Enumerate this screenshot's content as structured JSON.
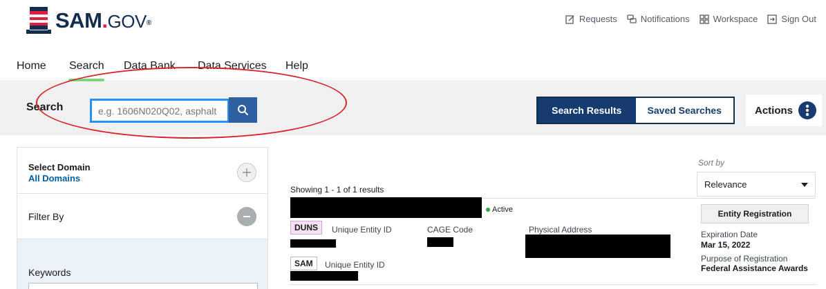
{
  "header": {
    "logo_main": "SAM",
    "logo_dot": ".",
    "logo_gov": "GOV",
    "logo_reg": "®",
    "util": {
      "requests": "Requests",
      "notifications": "Notifications",
      "workspace": "Workspace",
      "sign_out": "Sign Out"
    }
  },
  "nav": {
    "home": "Home",
    "search": "Search",
    "data_bank": "Data Bank",
    "data_services": "Data Services",
    "help": "Help"
  },
  "search": {
    "label": "Search",
    "placeholder": "e.g. 1606N020Q02, asphalt"
  },
  "toggle": {
    "results": "Search Results",
    "saved": "Saved Searches"
  },
  "actions": {
    "label": "Actions"
  },
  "sidebar": {
    "select_domain": "Select Domain",
    "all_domains": "All Domains",
    "filter_by": "Filter By",
    "keywords": "Keywords"
  },
  "results": {
    "showing": "Showing 1 - 1 of 1 results",
    "sort_by": "Sort by",
    "sort_value": "Relevance",
    "status": "Active",
    "duns_tag": "DUNS",
    "sam_tag": "SAM",
    "unique_entity_id": "Unique Entity ID",
    "cage_code": "CAGE Code",
    "physical_address": "Physical Address",
    "entity_registration": "Entity Registration",
    "expiration_label": "Expiration Date",
    "expiration_value": "Mar 15, 2022",
    "purpose_label": "Purpose of Registration",
    "purpose_value": "Federal Assistance Awards"
  },
  "colors": {
    "brand_navy": "#112e51",
    "primary_blue": "#163c6f",
    "active_underline": "#7bd67b",
    "annotation_red": "#d8242a",
    "focus_blue": "#2491ff"
  }
}
